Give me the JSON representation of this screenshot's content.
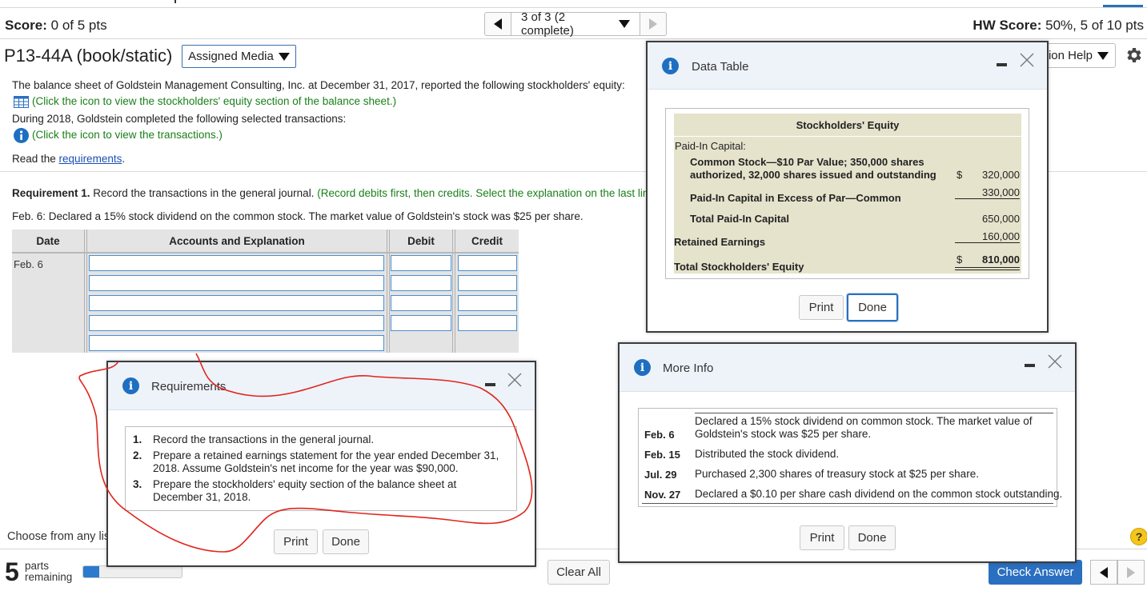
{
  "header": {
    "score_label": "Score:",
    "score_value": "0 of 5 pts",
    "nav_text": "3 of 3 (2 complete)",
    "hw_score_label": "HW Score:",
    "hw_score_value": "50%, 5 of 10 pts"
  },
  "problem": {
    "title": "P13-44A (book/static)",
    "assigned_media_label": "Assigned Media",
    "question_help_label": "tion Help"
  },
  "body": {
    "intro": "The balance sheet of Goldstein Management Consulting, Inc. at December 31, 2017, reported the following stockholders' equity:",
    "table_link": "(Click the icon to view the stockholders' equity section of the balance sheet.)",
    "during": "During 2018, Goldstein completed the following selected transactions:",
    "info_link": "(Click the icon to view the transactions.)",
    "read_the": "Read the ",
    "requirements_link": "requirements",
    "read_period": ".",
    "req1_bold": "Requirement 1.",
    "req1_text": " Record the transactions in the general journal. ",
    "req1_green": "(Record debits first, then credits. Select the explanation on the last line of t",
    "feb6_text": "Feb. 6: Declared a 15% stock dividend on the common stock. The market value of Goldstein's stock was $25 per share."
  },
  "journal": {
    "headers": [
      "Date",
      "Accounts and Explanation",
      "Debit",
      "Credit"
    ],
    "date": "Feb. 6",
    "rows": [
      {
        "account": "",
        "debit": "",
        "credit": ""
      },
      {
        "account": "",
        "debit": "",
        "credit": ""
      },
      {
        "account": "",
        "debit": "",
        "credit": ""
      },
      {
        "account": "",
        "debit": "",
        "credit": ""
      },
      {
        "account": ""
      }
    ]
  },
  "data_table_dialog": {
    "title": "Data Table",
    "heading": "Stockholders' Equity",
    "paid_in_label": "Paid-In Capital:",
    "common_stock_line1": "Common Stock—$10 Par Value; 350,000 shares",
    "common_stock_line2": "authorized, 32,000 shares issued and outstanding",
    "common_stock_dollar": "$",
    "common_stock_value": "320,000",
    "apic_label": "Paid-In Capital in Excess of Par—Common",
    "apic_value": "330,000",
    "total_paid_in_label": "Total Paid-In Capital",
    "total_paid_in_value": "650,000",
    "retained_label": "Retained Earnings",
    "retained_value": "160,000",
    "total_se_label": "Total Stockholders' Equity",
    "total_se_dollar": "$",
    "total_se_value": "810,000",
    "print_label": "Print",
    "done_label": "Done"
  },
  "more_info_dialog": {
    "title": "More Info",
    "transactions": [
      {
        "date": "Feb. 6",
        "line1": "Declared a 15% stock dividend on common stock. The market value of",
        "line2": "Goldstein's stock was $25 per share."
      },
      {
        "date": "Feb. 15",
        "line1": "Distributed the stock dividend."
      },
      {
        "date": "Jul. 29",
        "line1": "Purchased 2,300 shares of treasury stock at $25 per share."
      },
      {
        "date": "Nov. 27",
        "line1": "Declared a $0.10 per share cash dividend on the common stock outstanding."
      }
    ],
    "print_label": "Print",
    "done_label": "Done"
  },
  "requirements_dialog": {
    "title": "Requirements",
    "items": [
      {
        "num": "1.",
        "text": "Record the transactions in the general journal."
      },
      {
        "num": "2.",
        "text": "Prepare a retained earnings statement for the year ended December 31, 2018. Assume Goldstein's net income for the year was $90,000."
      },
      {
        "num": "3.",
        "text": "Prepare the stockholders' equity section of the balance sheet at December 31, 2018."
      }
    ],
    "print_label": "Print",
    "done_label": "Done"
  },
  "footer": {
    "choose_text": "Choose from any lis",
    "parts_count": "5",
    "parts_label_1": "parts",
    "parts_label_2": "remaining",
    "progress_fraction": 0.16,
    "clear_all_label": "Clear All",
    "check_answer_label": "Check Answer",
    "help_label": "?"
  },
  "colors": {
    "accent_blue": "#2a6fc0",
    "instruction_green": "#1a7f1a",
    "table_beige": "#e6e3cc",
    "annotation_red": "#e0251b"
  }
}
